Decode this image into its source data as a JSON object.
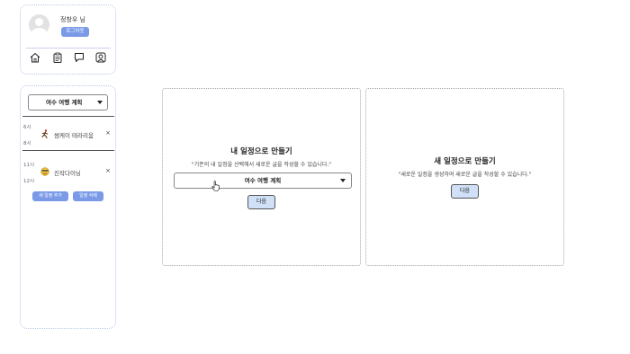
{
  "profile": {
    "username": "정창우 님",
    "logout_label": "로그아웃",
    "nav_icons": [
      "home-icon",
      "clipboard-icon",
      "chat-icon",
      "user-icon"
    ]
  },
  "schedule": {
    "selected_plan": "여수 여행 계획",
    "items": [
      {
        "start": "6시",
        "end": "8시",
        "icon": "running-person-icon",
        "label": "썸케이 테라리움"
      },
      {
        "start": "11시",
        "end": "12시",
        "icon": "smile-face-icon",
        "label": "진작다이닝"
      }
    ],
    "add_label": "새 일정 추가",
    "delete_label": "일정 삭제"
  },
  "existing_card": {
    "title": "내 일정으로 만들기",
    "description": "\"기존의 내 일정을 선택해서 새로운 글을 작성할 수 있습니다.\"",
    "selected_plan": "여수 여행 계획",
    "next_label": "다음"
  },
  "new_card": {
    "title": "새 일정으로 만들기",
    "description": "\"새로운 일정을 생성하여 새로운 글을 작성할 수 있습니다.\"",
    "next_label": "다음"
  },
  "colors": {
    "accent": "#7a9ae8",
    "next_button": "#cfe0f7"
  }
}
